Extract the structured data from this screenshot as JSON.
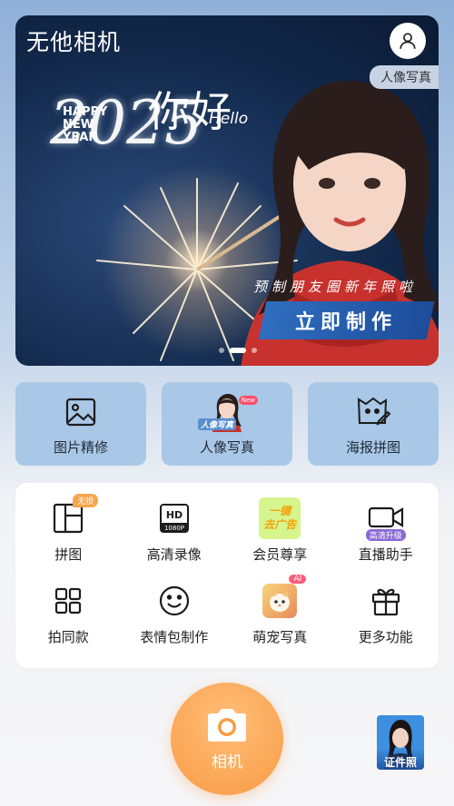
{
  "app": {
    "name": "无他相机"
  },
  "banner": {
    "portrait_tag": "人像写真",
    "greeting_cn": "你好",
    "greeting_hello": "Hello",
    "happy_new_year": [
      "HAPPY",
      "NEW YEAR"
    ],
    "year": "2025",
    "subtitle": "预制朋友圈新年照啦",
    "cta_label": "立即制作",
    "carousel": {
      "count": 3,
      "active_index": 1
    }
  },
  "feature_cards": [
    {
      "label": "图片精修",
      "icon": "image-icon"
    },
    {
      "label": "人像写真",
      "icon": "portrait-thumbnail",
      "thumb_tag": "人像写真",
      "badge": "New"
    },
    {
      "label": "海报拼图",
      "icon": "poster-icon"
    }
  ],
  "tools": [
    {
      "label": "拼图",
      "icon": "collage-icon",
      "badge": "无损"
    },
    {
      "label": "高清录像",
      "icon": "hd-video-icon",
      "hd_text": "HD",
      "res_text": "1080P"
    },
    {
      "label": "会员尊享",
      "icon": "remove-ads-icon",
      "ad_text": [
        "一键",
        "去广告"
      ]
    },
    {
      "label": "直播助手",
      "icon": "video-camera-icon",
      "badge": "高清升级"
    },
    {
      "label": "拍同款",
      "icon": "layout-icon"
    },
    {
      "label": "表情包制作",
      "icon": "smiley-icon"
    },
    {
      "label": "萌宠写真",
      "icon": "pet-icon",
      "badge": "AI"
    },
    {
      "label": "更多功能",
      "icon": "gift-icon"
    }
  ],
  "bottom": {
    "camera_label": "相机",
    "id_photo_label": "证件照"
  },
  "colors": {
    "accent_orange": "#f99b45",
    "card_blue": "#a9c7e6",
    "cta_blue": "#2f6ec0"
  }
}
